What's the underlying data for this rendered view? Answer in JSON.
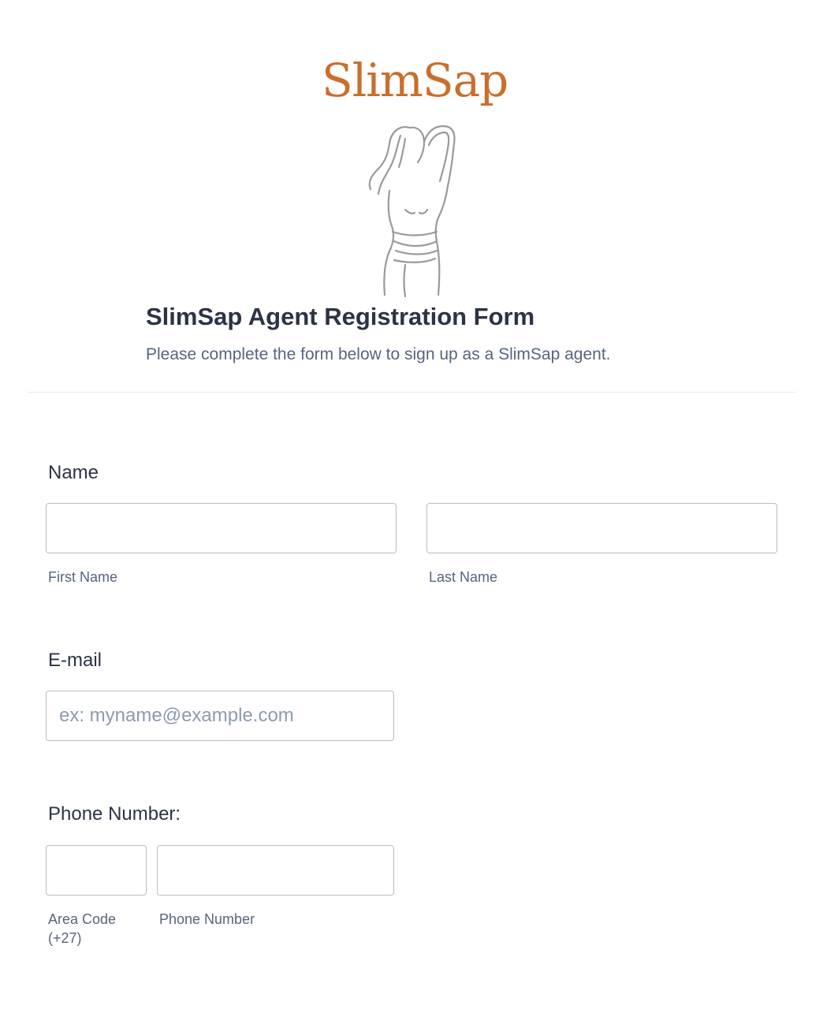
{
  "brand": {
    "name": "SlimSap",
    "accent_color": "#c96f2d"
  },
  "header": {
    "title": "SlimSap Agent Registration Form",
    "subtitle": "Please complete the form below to sign up as a SlimSap agent."
  },
  "fields": {
    "name": {
      "label": "Name",
      "first_value": "",
      "first_sublabel": "First Name",
      "last_value": "",
      "last_sublabel": "Last Name"
    },
    "email": {
      "label": "E-mail",
      "value": "",
      "placeholder": "ex: myname@example.com"
    },
    "phone": {
      "label": "Phone Number:",
      "area_value": "",
      "area_sublabel_line1": "Area Code",
      "area_sublabel_line2": "(+27)",
      "number_value": "",
      "number_sublabel": "Phone Number"
    }
  },
  "colors": {
    "text": "#2c3345",
    "muted_text": "#57647e",
    "placeholder": "#8d9ab0",
    "input_border": "#b8bdc9",
    "divider": "#e6e9ef"
  }
}
